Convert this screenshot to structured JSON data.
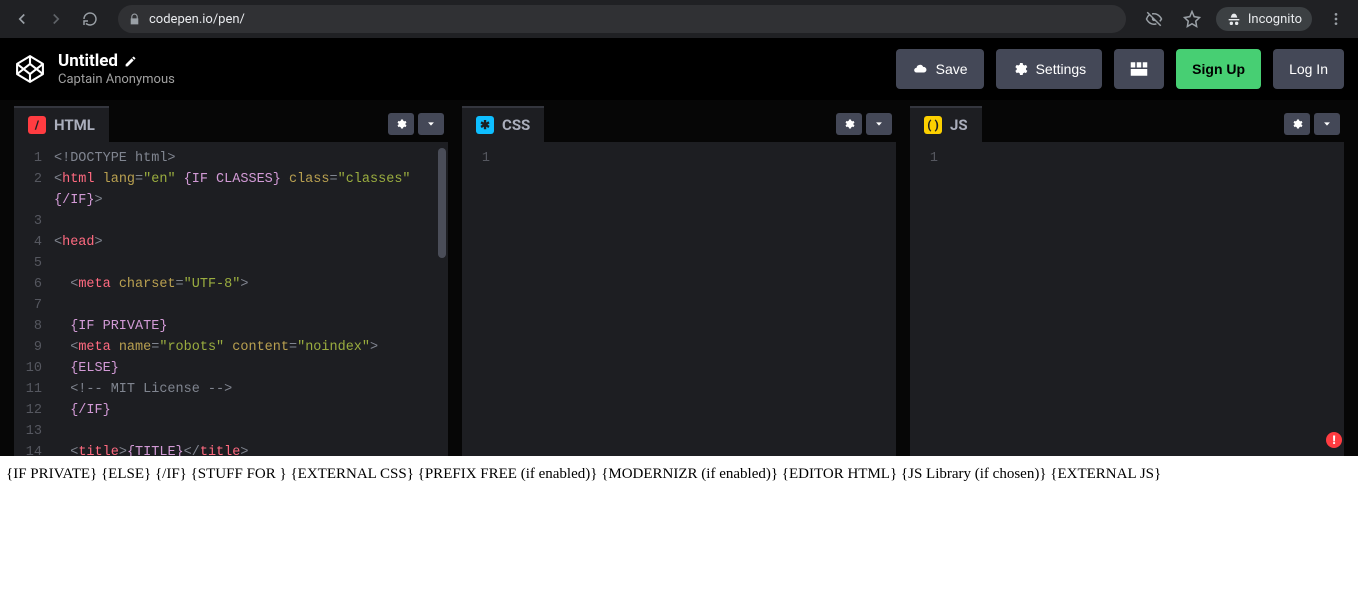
{
  "browser": {
    "url": "codepen.io/pen/",
    "incognito_label": "Incognito"
  },
  "header": {
    "title": "Untitled",
    "author": "Captain Anonymous",
    "save": "Save",
    "settings": "Settings",
    "signup": "Sign Up",
    "login": "Log In"
  },
  "editors": {
    "html": {
      "label": "HTML"
    },
    "css": {
      "label": "CSS"
    },
    "js": {
      "label": "JS"
    }
  },
  "html_code": {
    "gutter": [
      "1",
      "2",
      "",
      "3",
      "4",
      "5",
      "6",
      "7",
      "8",
      "9",
      "10",
      "11",
      "12",
      "13",
      "14"
    ],
    "lines": [
      {
        "type": "doctype",
        "raw": "<!DOCTYPE html>"
      },
      {
        "type": "html_open",
        "pre": "<",
        "tag": "html",
        "attrs": [
          [
            "lang",
            "\"en\""
          ]
        ],
        "tail": " {IF CLASSES}",
        "attrs2": [
          [
            "class",
            "\"classes\""
          ]
        ]
      },
      {
        "type": "cont",
        "text": "{/IF}>"
      },
      {
        "type": "blank"
      },
      {
        "type": "tag_open",
        "tag": "head"
      },
      {
        "type": "blank"
      },
      {
        "type": "meta1",
        "tag": "meta",
        "attrs": [
          [
            "charset",
            "\"UTF-8\""
          ]
        ]
      },
      {
        "type": "blank"
      },
      {
        "type": "tmpl",
        "text": "{IF PRIVATE}"
      },
      {
        "type": "meta2",
        "tag": "meta",
        "attrs": [
          [
            "name",
            "\"robots\""
          ],
          [
            "content",
            "\"noindex\""
          ]
        ]
      },
      {
        "type": "tmpl",
        "text": "{ELSE}"
      },
      {
        "type": "comment",
        "text": "<!-- MIT License -->"
      },
      {
        "type": "tmpl",
        "text": "{/IF}"
      },
      {
        "type": "blank"
      },
      {
        "type": "title",
        "tag": "title",
        "inner": "{TITLE}"
      }
    ]
  },
  "preview": {
    "tokens": [
      "{IF PRIVATE}",
      "{ELSE}",
      "{/IF}",
      "{STUFF FOR }",
      "{EXTERNAL CSS}",
      "{PREFIX FREE (if enabled)}",
      "{MODERNIZR (if enabled)}",
      "{EDITOR HTML}",
      "{JS Library (if chosen)}",
      "{EXTERNAL JS}"
    ]
  },
  "error_badge": "!"
}
